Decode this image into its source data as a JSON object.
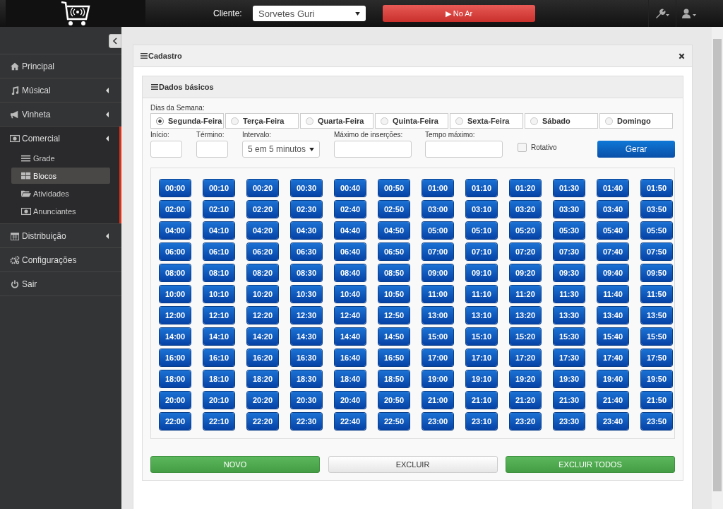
{
  "topbar": {
    "client_label": "Cliente:",
    "client_value": "Sorvetes Guri",
    "on_air_button": "▶ No Ar"
  },
  "sidebar": {
    "items": [
      {
        "label": "Principal",
        "has_submenu": false,
        "selected": false
      },
      {
        "label": "Músical",
        "has_submenu": true,
        "selected": false
      },
      {
        "label": "Vinheta",
        "has_submenu": true,
        "selected": false
      },
      {
        "label": "Comercial",
        "has_submenu": true,
        "selected": true,
        "children": [
          {
            "label": "Grade",
            "selected": false
          },
          {
            "label": "Blocos",
            "selected": true
          },
          {
            "label": "Atividades",
            "selected": false
          },
          {
            "label": "Anunciantes",
            "selected": false
          }
        ]
      },
      {
        "label": "Distribuição",
        "has_submenu": true,
        "selected": false
      },
      {
        "label": "Configurações",
        "has_submenu": false,
        "selected": false
      },
      {
        "label": "Sair",
        "has_submenu": false,
        "selected": false
      }
    ]
  },
  "panel": {
    "title": "Cadastro",
    "section_title": "Dados básicos",
    "days_label": "Dias da Semana:",
    "days": [
      {
        "label": "Segunda-Feira",
        "selected": true
      },
      {
        "label": "Terça-Feira",
        "selected": false
      },
      {
        "label": "Quarta-Feira",
        "selected": false
      },
      {
        "label": "Quinta-Feira",
        "selected": false
      },
      {
        "label": "Sexta-Feira",
        "selected": false
      },
      {
        "label": "Sábado",
        "selected": false
      },
      {
        "label": "Domingo",
        "selected": false
      }
    ],
    "fields": [
      {
        "label": "Início:",
        "kind": "small"
      },
      {
        "label": "Término:",
        "kind": "small"
      },
      {
        "label": "Intervalo:",
        "kind": "select",
        "value": "5 em 5 minutos"
      },
      {
        "label": "Máximo de inserções:",
        "kind": "wide"
      },
      {
        "label": "Tempo máximo:",
        "kind": "wide"
      }
    ],
    "rotativo": {
      "label": "Rotativo",
      "checked": false
    },
    "generate_button": "Gerar",
    "times": [
      "00:00",
      "00:10",
      "00:20",
      "00:30",
      "00:40",
      "00:50",
      "01:00",
      "01:10",
      "01:20",
      "01:30",
      "01:40",
      "01:50",
      "02:00",
      "02:10",
      "02:20",
      "02:30",
      "02:40",
      "02:50",
      "03:00",
      "03:10",
      "03:20",
      "03:30",
      "03:40",
      "03:50",
      "04:00",
      "04:10",
      "04:20",
      "04:30",
      "04:40",
      "04:50",
      "05:00",
      "05:10",
      "05:20",
      "05:30",
      "05:40",
      "05:50",
      "06:00",
      "06:10",
      "06:20",
      "06:30",
      "06:40",
      "06:50",
      "07:00",
      "07:10",
      "07:20",
      "07:30",
      "07:40",
      "07:50",
      "08:00",
      "08:10",
      "08:20",
      "08:30",
      "08:40",
      "08:50",
      "09:00",
      "09:10",
      "09:20",
      "09:30",
      "09:40",
      "09:50",
      "10:00",
      "10:10",
      "10:20",
      "10:30",
      "10:40",
      "10:50",
      "11:00",
      "11:10",
      "11:20",
      "11:30",
      "11:40",
      "11:50",
      "12:00",
      "12:10",
      "12:20",
      "12:30",
      "12:40",
      "12:50",
      "13:00",
      "13:10",
      "13:20",
      "13:30",
      "13:40",
      "13:50",
      "14:00",
      "14:10",
      "14:20",
      "14:30",
      "14:40",
      "14:50",
      "15:00",
      "15:10",
      "15:20",
      "15:30",
      "15:40",
      "15:50",
      "16:00",
      "16:10",
      "16:20",
      "16:30",
      "16:40",
      "16:50",
      "17:00",
      "17:10",
      "17:20",
      "17:30",
      "17:40",
      "17:50",
      "18:00",
      "18:10",
      "18:20",
      "18:30",
      "18:40",
      "18:50",
      "19:00",
      "19:10",
      "19:20",
      "19:30",
      "19:40",
      "19:50",
      "20:00",
      "20:10",
      "20:20",
      "20:30",
      "20:40",
      "20:50",
      "21:00",
      "21:10",
      "21:20",
      "21:30",
      "21:40",
      "21:50",
      "22:00",
      "22:10",
      "22:20",
      "22:30",
      "22:40",
      "22:50",
      "23:00",
      "23:10",
      "23:20",
      "23:30",
      "23:40",
      "23:50"
    ],
    "actions": [
      {
        "label": "NOVO",
        "kind": "success"
      },
      {
        "label": "EXCLUIR",
        "kind": "default"
      },
      {
        "label": "EXCLUIR TODOS",
        "kind": "success"
      }
    ]
  }
}
